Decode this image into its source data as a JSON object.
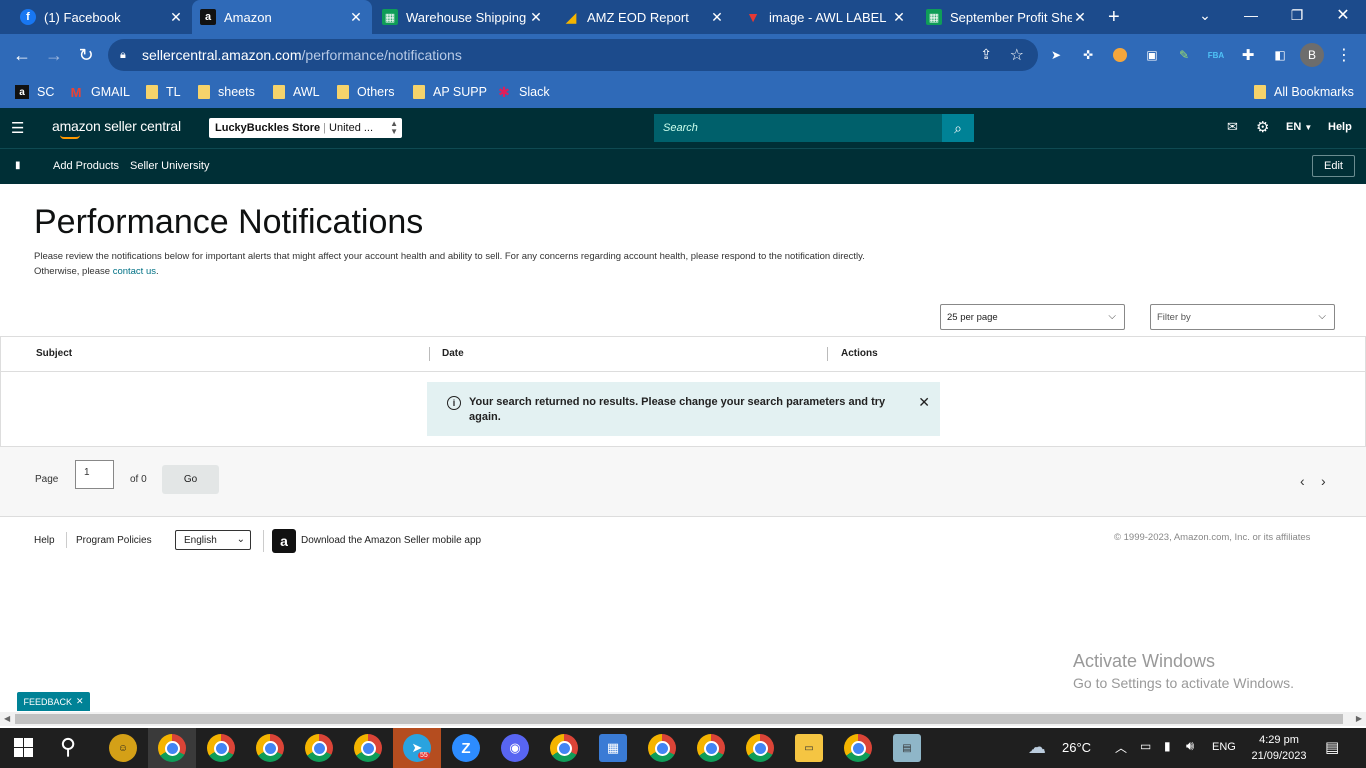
{
  "browser": {
    "tabs": [
      {
        "title": "(1) Facebook",
        "icon": "facebook-icon",
        "color": "#1877f2",
        "glyph": "f"
      },
      {
        "title": "Amazon",
        "icon": "amazon-icon",
        "color": "#111111",
        "glyph": "a"
      },
      {
        "title": "Warehouse Shipping &",
        "icon": "sheets-icon",
        "color": "#0f9d58",
        "glyph": "▦"
      },
      {
        "title": "AMZ EOD Report",
        "icon": "report-icon",
        "color": "#f4b400",
        "glyph": "◢"
      },
      {
        "title": "image - AWL LABEL",
        "icon": "awl-icon",
        "color": "#d32f2f",
        "glyph": "▼"
      },
      {
        "title": "September Profit Shee",
        "icon": "sheets-icon",
        "color": "#0f9d58",
        "glyph": "▦"
      }
    ],
    "new_tab": "+",
    "url_host": "sellercentral.amazon.com",
    "url_path": "/performance/notifications",
    "profile_initial": "B",
    "bookmarks": [
      {
        "label": "SC",
        "icon": "amazon-icon"
      },
      {
        "label": "GMAIL",
        "icon": "gmail-icon"
      },
      {
        "label": "TL",
        "icon": "folder-icon"
      },
      {
        "label": "sheets",
        "icon": "folder-icon"
      },
      {
        "label": "AWL",
        "icon": "folder-icon"
      },
      {
        "label": "Others",
        "icon": "folder-icon"
      },
      {
        "label": "AP SUPP",
        "icon": "folder-icon"
      },
      {
        "label": "Slack",
        "icon": "slack-icon"
      }
    ],
    "all_bookmarks": "All Bookmarks"
  },
  "seller_central": {
    "logo": "amazon seller central",
    "store_name": "LuckyBuckles Store",
    "store_region": "United ...",
    "search_placeholder": "Search",
    "language": "EN",
    "help": "Help",
    "nav": [
      "Add Products",
      "Seller University"
    ],
    "edit": "Edit"
  },
  "page": {
    "title": "Performance Notifications",
    "intro": "Please review the notifications below for important alerts that might affect your account health and ability to sell. For any concerns regarding account health, please respond to the notification directly. Otherwise, please",
    "intro_link": "contact us",
    "intro_end": ".",
    "per_page": "25 per page",
    "filter": "Filter by",
    "columns": [
      "Subject",
      "Date",
      "Actions"
    ],
    "alert": "Your search returned no results. Please change your search parameters and try again.",
    "pager": {
      "label": "Page",
      "value": "1",
      "of": "of 0",
      "go": "Go"
    }
  },
  "footer": {
    "help": "Help",
    "policies": "Program Policies",
    "language": "English",
    "app": "Download the Amazon Seller mobile app",
    "copyright": "© 1999-2023, Amazon.com, Inc. or its affiliates"
  },
  "watermark": {
    "line1": "Activate Windows",
    "line2": "Go to Settings to activate Windows."
  },
  "feedback": "FEEDBACK",
  "taskbar": {
    "weather": "26°C",
    "lang": "ENG",
    "time": "4:29 pm",
    "date": "21/09/2023",
    "telegram_badge": "55"
  }
}
